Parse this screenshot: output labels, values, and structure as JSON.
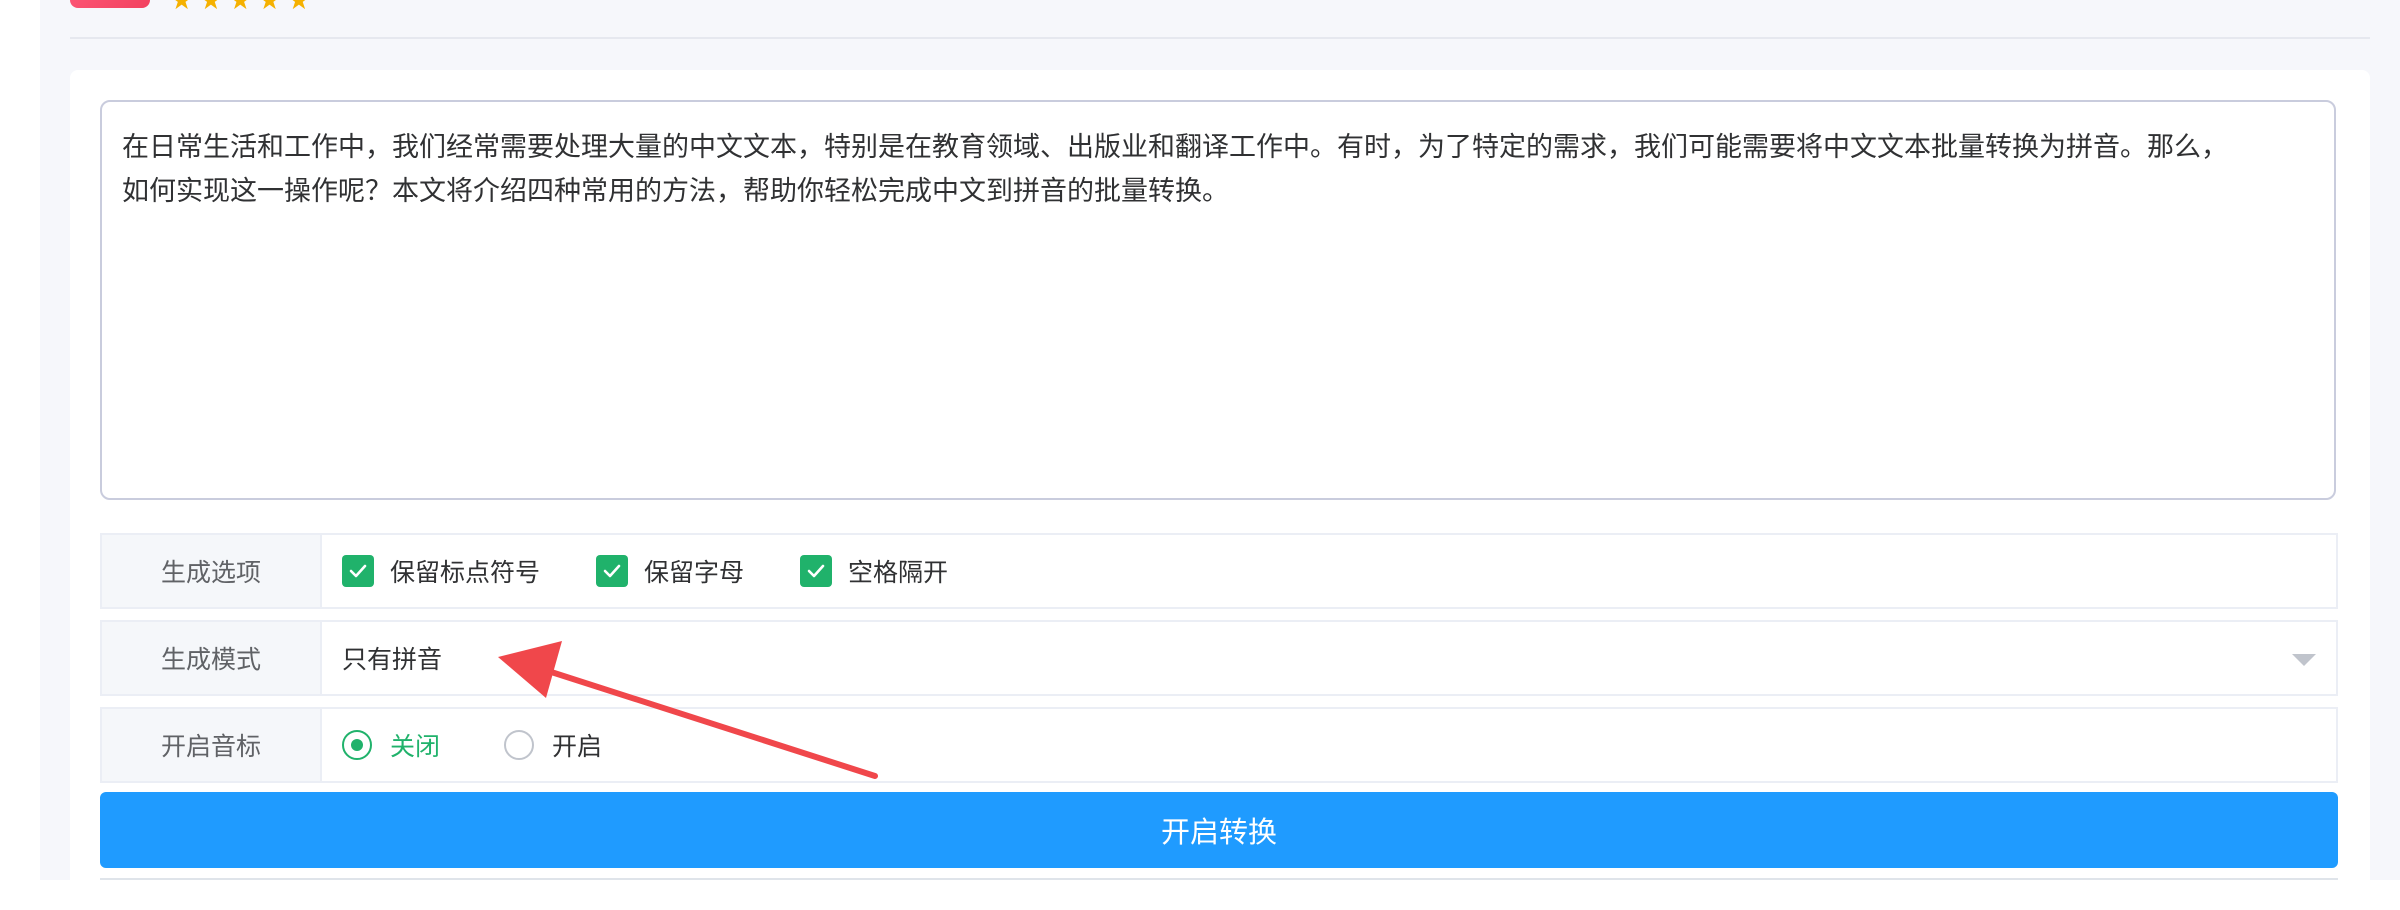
{
  "header": {
    "logo": "app-logo",
    "rating_stars": "★★★★★"
  },
  "editor": {
    "text": "在日常生活和工作中，我们经常需要处理大量的中文文本，特别是在教育领域、出版业和翻译工作中。有时，为了特定的需求，我们可能需要将中文文本批量转换为拼音。那么，\n如何实现这一操作呢？本文将介绍四种常用的方法，帮助你轻松完成中文到拼音的批量转换。"
  },
  "options": {
    "label": "生成选项",
    "items": [
      {
        "label": "保留标点符号",
        "checked": true
      },
      {
        "label": "保留字母",
        "checked": true
      },
      {
        "label": "空格隔开",
        "checked": true
      }
    ]
  },
  "mode": {
    "label": "生成模式",
    "selected": "只有拼音"
  },
  "tone": {
    "label": "开启音标",
    "options": [
      {
        "label": "关闭",
        "selected": true
      },
      {
        "label": "开启",
        "selected": false
      }
    ]
  },
  "actions": {
    "convert_label": "开启转换"
  },
  "annotation": {
    "arrow_color": "#f0474b"
  },
  "colors": {
    "accent_green": "#20b26b",
    "primary_blue": "#1f9bff"
  }
}
